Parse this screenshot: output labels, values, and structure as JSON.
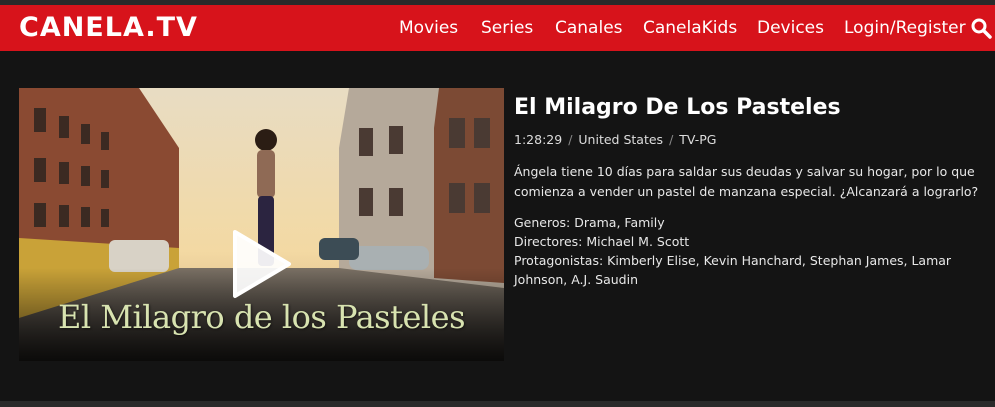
{
  "brand": {
    "logo": "CANELA.TV",
    "color": "#d7131b"
  },
  "nav": {
    "movies": "Movies",
    "series": "Series",
    "canales": "Canales",
    "kids": "CanelaKids",
    "devices": "Devices",
    "login": "Login/Register",
    "search_icon": "search-icon"
  },
  "hero": {
    "title_art": "El Milagro de los Pasteles",
    "play_icon": "play-icon"
  },
  "movie": {
    "title": "El Milagro De Los Pasteles",
    "duration": "1:28:29",
    "country": "United States",
    "rating": "TV-PG",
    "separator": "/",
    "description": "Ángela tiene 10 días para saldar sus deudas y salvar su hogar, por lo que comienza a vender un pastel de manzana especial. ¿Alcanzará a lograrlo?",
    "genres": "Generos: Drama, Family",
    "directors": "Directores: Michael M. Scott",
    "cast": "Protagonistas: Kimberly Elise, Kevin Hanchard, Stephan James, Lamar Johnson, A.J. Saudin"
  }
}
